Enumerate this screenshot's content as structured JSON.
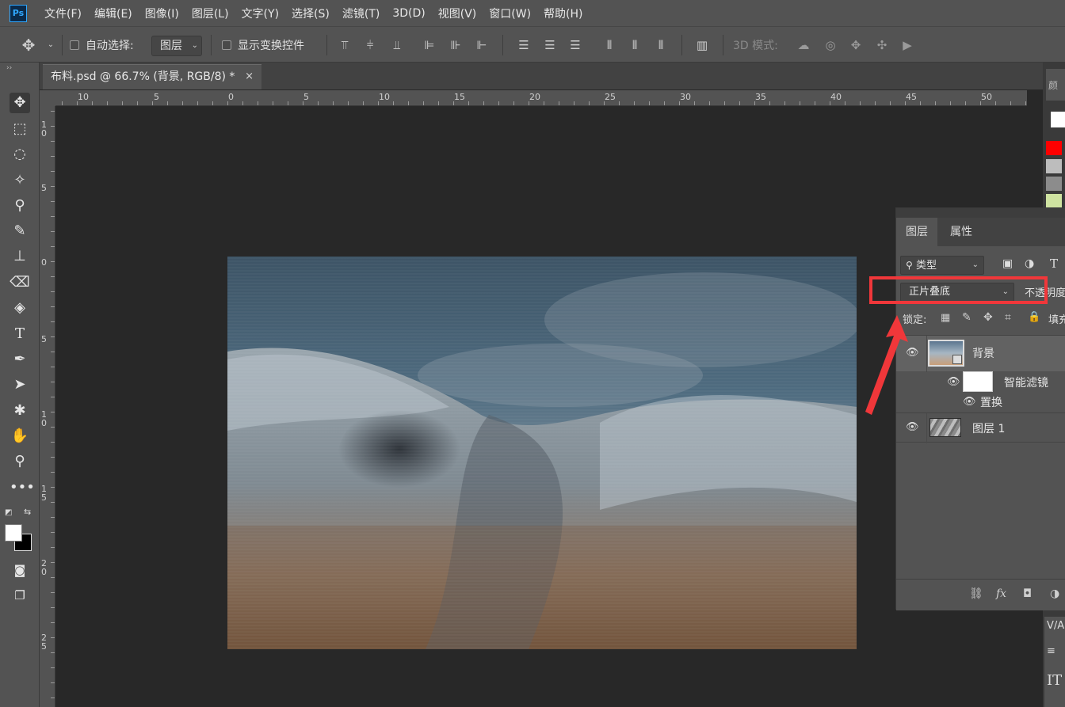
{
  "app": {
    "logo": "Ps"
  },
  "menubar": {
    "items": [
      "文件(F)",
      "编辑(E)",
      "图像(I)",
      "图层(L)",
      "文字(Y)",
      "选择(S)",
      "滤镜(T)",
      "3D(D)",
      "视图(V)",
      "窗口(W)",
      "帮助(H)"
    ]
  },
  "options": {
    "auto_select_label": "自动选择:",
    "auto_select_value": "图层",
    "show_transform_label": "显示变换控件",
    "mode_3d_label": "3D 模式:"
  },
  "document": {
    "tab_title": "布料.psd @ 66.7% (背景, RGB/8) *",
    "close_glyph": "×"
  },
  "rulers": {
    "horizontal": [
      "10",
      "5",
      "0",
      "5",
      "10",
      "15",
      "20",
      "25",
      "30",
      "35",
      "40",
      "45",
      "50"
    ],
    "vertical": [
      "1\n0",
      "5",
      "0",
      "5",
      "1\n0",
      "1\n5",
      "2\n0",
      "2\n5"
    ]
  },
  "layers_panel": {
    "tabs": [
      "图层",
      "属性"
    ],
    "filter_label": "类型",
    "blend_mode": "正片叠底",
    "opacity_label": "不透明度",
    "lock_label": "锁定:",
    "fill_label": "填充",
    "layers": [
      {
        "name": "背景",
        "type": "smart-object"
      },
      {
        "name": "智能滤镜",
        "type": "smart-filter"
      },
      {
        "name": "置换",
        "type": "filter"
      },
      {
        "name": "图层 1",
        "type": "pixel"
      }
    ]
  },
  "colors": {
    "annotation_red": "#f0373a",
    "swatch_red": "#ff0000",
    "swatch_light_gray": "#bdbdbd",
    "swatch_dark_gray": "#8c8c8c",
    "swatch_green": "#cfe3a1"
  }
}
